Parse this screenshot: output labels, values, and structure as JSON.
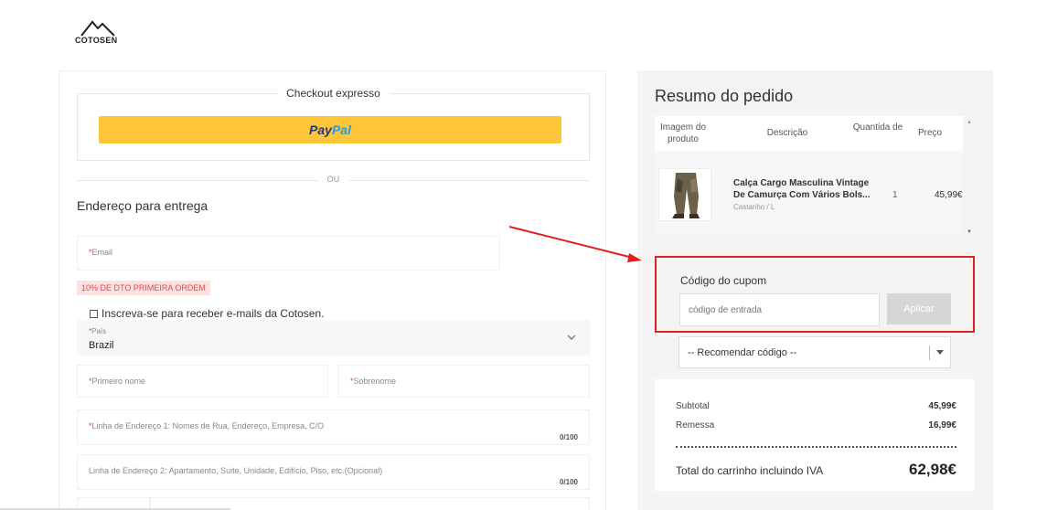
{
  "brand": {
    "logo_text": "COTOSEN"
  },
  "checkout": {
    "express_title": "Checkout expresso",
    "paypal_part1": "Pay",
    "paypal_part2": "Pal",
    "divider_text": "OU",
    "shipping_title": "Endereço para entrega",
    "email_label": "Email",
    "promo_badge": "10% DE DTO PRIMEIRA ORDEM",
    "subscribe_label": "Inscreva-se para receber e-mails da Cotosen.",
    "subscribe_checked": false,
    "country_label": "País",
    "country_value": "Brazil",
    "first_name_label": "Primeiro nome",
    "last_name_label": "Sobrenome",
    "address1_label": "Linha de Endereço 1: Nomes de Rua, Endereço, Empresa, C/O",
    "address1_counter": "0/100",
    "address2_label": "Linha de Endereço 2: Apartamento, Suite, Unidade, Edifício, Piso, etc.(Opcional)",
    "address2_counter": "0/100"
  },
  "summary": {
    "title": "Resumo do pedido",
    "columns": {
      "image": "Imagem do produto",
      "description": "Descrição",
      "quantity": "Quantida de",
      "price": "Preço"
    },
    "item": {
      "name": "Calça Cargo Masculina Vintage De Camurça Com Vários Bols...",
      "variant": "Castanho / L",
      "quantity": "1",
      "price": "45,99€"
    },
    "coupon_title": "Código do cupom",
    "coupon_placeholder": "código de entrada",
    "apply_label": "Aplicar",
    "recommend_label": "-- Recomendar código --",
    "subtotal_label": "Subtotal",
    "subtotal_value": "45,99€",
    "shipping_label": "Remessa",
    "shipping_value": "16,99€",
    "total_label": "Total do carrinho incluindo IVA",
    "total_value": "62,98€"
  },
  "colors": {
    "paypal_bg": "#fcc53a",
    "highlight": "#e02020",
    "apply_disabled": "#d6d6d6"
  }
}
